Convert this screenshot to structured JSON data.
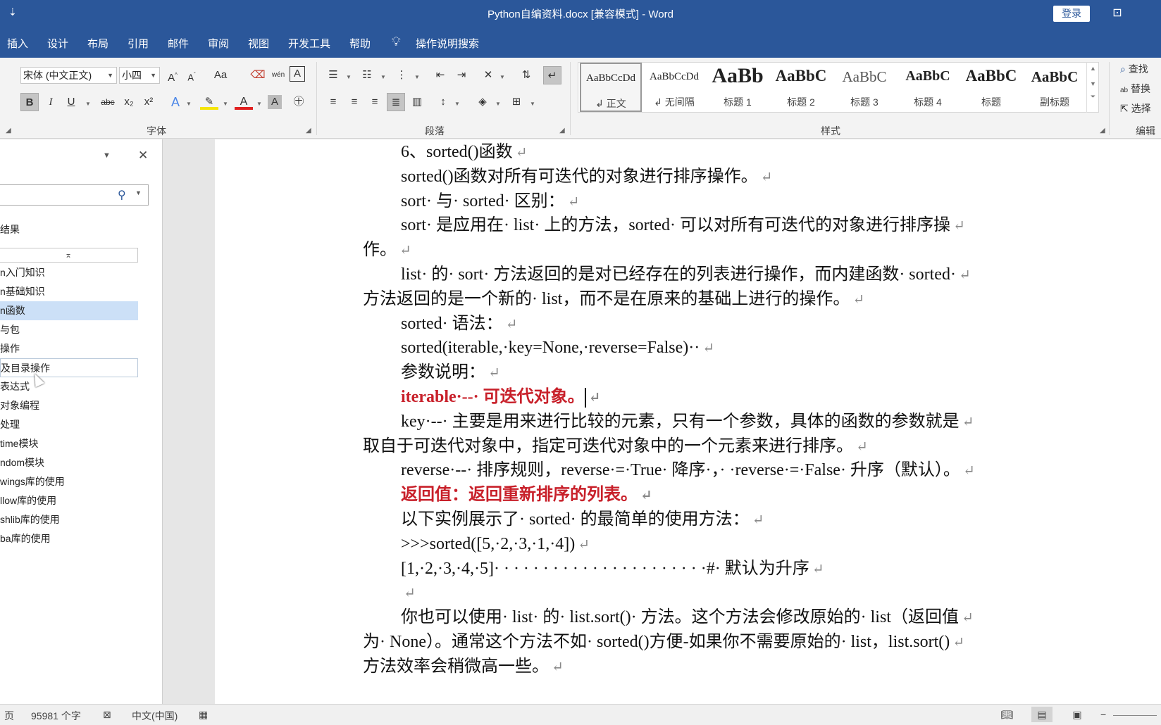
{
  "titlebar": {
    "qat_label": "⇣",
    "title": "Python自编资料.docx [兼容模式]  -  Word",
    "login_label": "登录",
    "ribbon_display_icon": "⊡"
  },
  "menu": {
    "tabs": [
      "插入",
      "设计",
      "布局",
      "引用",
      "邮件",
      "审阅",
      "视图",
      "开发工具",
      "帮助"
    ],
    "search_label": "操作说明搜索"
  },
  "ribbon": {
    "font": {
      "group_label": "字体",
      "font_name": "宋体 (中文正文)",
      "font_size": "小四",
      "grow_label": "A",
      "shrink_label": "A",
      "case_label": "Aa",
      "phonetic_label": "wén",
      "bold": "B",
      "italic": "I",
      "underline": "U",
      "strike": "abc",
      "subscript": "x₂",
      "superscript": "x²",
      "font_color_label": "A",
      "shading_label": "A"
    },
    "paragraph": {
      "group_label": "段落"
    },
    "styles": {
      "group_label": "样式",
      "items": [
        {
          "sample": "AaBbCcDd",
          "name": "↲ 正文"
        },
        {
          "sample": "AaBbCcDd",
          "name": "↲ 无间隔"
        },
        {
          "sample": "AaBb",
          "name": "标题 1"
        },
        {
          "sample": "AaBbC",
          "name": "标题 2"
        },
        {
          "sample": "AaBbC",
          "name": "标题 3"
        },
        {
          "sample": "AaBbC",
          "name": "标题 4"
        },
        {
          "sample": "AaBbC",
          "name": "标题"
        },
        {
          "sample": "AaBbC",
          "name": "副标题"
        }
      ]
    },
    "editing": {
      "group_label": "编辑",
      "find": "查找",
      "replace": "替换",
      "select": "选择"
    }
  },
  "nav_pane": {
    "results_label": "结果",
    "collapse_label": "⌅",
    "items": [
      "n入门知识",
      "n基础知识",
      "n函数",
      "与包",
      "操作",
      "及目录操作",
      "表达式",
      "对象编程",
      "处理",
      "time模块",
      "ndom模块",
      "wings库的使用",
      "llow库的使用",
      "shlib库的使用",
      "ba库的使用"
    ]
  },
  "document": {
    "paragraphs": [
      {
        "text": "6、sorted()函数",
        "indent": true
      },
      {
        "text": "sorted()函数对所有可迭代的对象进行排序操作。",
        "indent": true
      },
      {
        "text": "sort· 与· sorted· 区别：",
        "indent": true
      },
      {
        "text": "sort· 是应用在· list· 上的方法，sorted· 可以对所有可迭代的对象进行排序操",
        "indent": true
      },
      {
        "text": "作。",
        "indent": false
      },
      {
        "text": "list· 的· sort· 方法返回的是对已经存在的列表进行操作，而内建函数· sorted·",
        "indent": true
      },
      {
        "text": "方法返回的是一个新的· list，而不是在原来的基础上进行的操作。",
        "indent": false
      },
      {
        "text": "sorted· 语法：",
        "indent": true
      },
      {
        "text": "sorted(iterable,·key=None,·reverse=False)··",
        "indent": true
      },
      {
        "text": "参数说明：",
        "indent": true
      },
      {
        "text": "iterable·--· 可迭代对象。",
        "indent": true,
        "red": true,
        "caret": true
      },
      {
        "text": "key·--· 主要是用来进行比较的元素，只有一个参数，具体的函数的参数就是",
        "indent": true
      },
      {
        "text": "取自于可迭代对象中，指定可迭代对象中的一个元素来进行排序。",
        "indent": false
      },
      {
        "text": "reverse·--· 排序规则，reverse·=·True· 降序·，· ·reverse·=·False· 升序（默认）。",
        "indent": true
      },
      {
        "text": "返回值：返回重新排序的列表。",
        "indent": true,
        "red": true
      },
      {
        "text": "以下实例展示了· sorted· 的最简单的使用方法：",
        "indent": true
      },
      {
        "text": ">>>sorted([5,·2,·3,·1,·4])",
        "indent": true
      },
      {
        "text": "[1,·2,·3,·4,·5]· · · · · · · · · · · · · · · · · · · · · ·#· 默认为升序",
        "indent": true
      },
      {
        "text": "",
        "indent": true
      },
      {
        "text": "你也可以使用· list· 的· list.sort()· 方法。这个方法会修改原始的· list（返回值",
        "indent": true
      },
      {
        "text": "为· None）。通常这个方法不如· sorted()方便-如果你不需要原始的· list，list.sort()",
        "indent": false
      },
      {
        "text": "方法效率会稍微高一些。",
        "indent": false
      }
    ],
    "paragraph_mark": "↵"
  },
  "statusbar": {
    "page_label": "页",
    "word_count": "95981 个字",
    "language": "中文(中国)"
  },
  "colors": {
    "brand": "#2b579a",
    "red_text": "#c8202a",
    "nav_selected": "#cce0f7"
  }
}
